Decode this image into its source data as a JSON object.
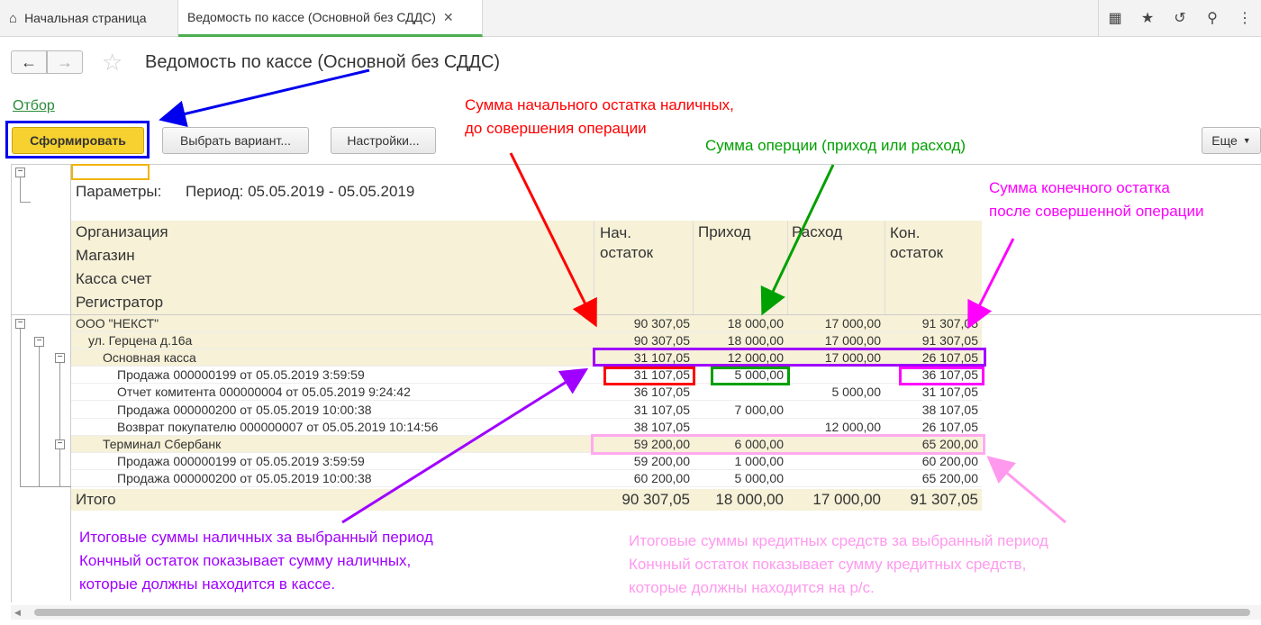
{
  "tabs": {
    "home": "Начальная страница",
    "report": "Ведомость по кассе (Основной без СДДС)"
  },
  "header": {
    "title": "Ведомость по кассе (Основной без СДДС)",
    "filter": "Отбор"
  },
  "toolbar": {
    "generate": "Сформировать",
    "choose_variant": "Выбрать вариант...",
    "settings": "Настройки...",
    "more": "Еще"
  },
  "report": {
    "params_label": "Параметры:",
    "period": "Период: 05.05.2019 - 05.05.2019",
    "group_headers": [
      "Организация",
      "Магазин",
      "Касса счет",
      "Регистратор"
    ],
    "columns": [
      "Нач. остаток",
      "Приход",
      "Расход",
      "Кон. остаток"
    ],
    "rows": [
      {
        "label": "ООО \"НЕКСТ\"",
        "v": [
          "90 307,05",
          "18 000,00",
          "17 000,00",
          "91 307,05"
        ]
      },
      {
        "label": "ул. Герцена д.16а",
        "v": [
          "90 307,05",
          "18 000,00",
          "17 000,00",
          "91 307,05"
        ]
      },
      {
        "label": "Основная касса",
        "v": [
          "31 107,05",
          "12 000,00",
          "17 000,00",
          "26 107,05"
        ]
      },
      {
        "label": "Продажа 000000199 от 05.05.2019 3:59:59",
        "v": [
          "31 107,05",
          "5 000,00",
          "",
          "36 107,05"
        ]
      },
      {
        "label": "Отчет комитента 000000004 от 05.05.2019 9:24:42",
        "v": [
          "36 107,05",
          "",
          "5 000,00",
          "31 107,05"
        ]
      },
      {
        "label": "Продажа 000000200 от 05.05.2019 10:00:38",
        "v": [
          "31 107,05",
          "7 000,00",
          "",
          "38 107,05"
        ]
      },
      {
        "label": "Возврат покупателю 000000007 от 05.05.2019 10:14:56",
        "v": [
          "38 107,05",
          "",
          "12 000,00",
          "26 107,05"
        ]
      },
      {
        "label": "Терминал Сбербанк",
        "v": [
          "59 200,00",
          "6 000,00",
          "",
          "65 200,00"
        ]
      },
      {
        "label": "Продажа 000000199 от 05.05.2019 3:59:59",
        "v": [
          "59 200,00",
          "1 000,00",
          "",
          "60 200,00"
        ]
      },
      {
        "label": "Продажа 000000200 от 05.05.2019 10:00:38",
        "v": [
          "60 200,00",
          "5 000,00",
          "",
          "65 200,00"
        ]
      }
    ],
    "total": {
      "label": "Итого",
      "v": [
        "90 307,05",
        "18 000,00",
        "17 000,00",
        "91 307,05"
      ]
    }
  },
  "annotations": {
    "red": [
      "Сумма начального остатка наличных,",
      "до совершения операции"
    ],
    "green": [
      "Сумма оперции (приход или расход)"
    ],
    "magenta": [
      "Сумма конечного остатка",
      "после совершенной операции"
    ],
    "purple": [
      "Итоговые суммы наличных за выбранный период",
      "Кончный остаток показывает сумму наличных,",
      "которые должны находится в кассе."
    ],
    "pink": [
      "Итоговые суммы кредитных средств за выбранный период",
      "Кончный остаток показывает сумму кредитных средств,",
      "которые должны находится на р/с."
    ]
  },
  "colors": {
    "red": "#ff0000",
    "green": "#00a000",
    "magenta": "#ff00ff",
    "purple": "#a000ff",
    "pink": "#ff88ee",
    "blue": "#0000ee"
  }
}
